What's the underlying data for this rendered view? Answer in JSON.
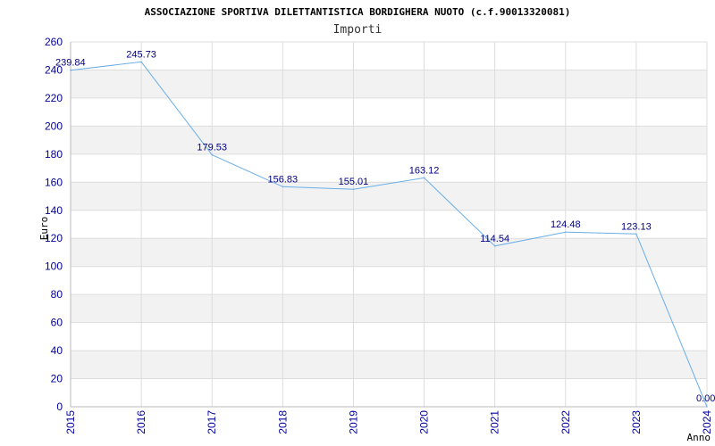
{
  "chart_data": {
    "type": "line",
    "title": "ASSOCIAZIONE SPORTIVA DILETTANTISTICA BORDIGHERA NUOTO (c.f.90013320081)",
    "subtitle": "Importi",
    "xlabel": "Anno",
    "ylabel": "Euro",
    "categories": [
      "2015",
      "2016",
      "2017",
      "2018",
      "2019",
      "2020",
      "2021",
      "2022",
      "2023",
      "2024"
    ],
    "series": [
      {
        "values": [
          239.84,
          245.73,
          179.53,
          156.83,
          155.01,
          163.12,
          114.54,
          124.48,
          123.13,
          0.0
        ]
      }
    ],
    "data_labels": [
      "239.84",
      "245.73",
      "179.53",
      "156.83",
      "155.01",
      "163.12",
      "114.54",
      "124.48",
      "123.13",
      "0.00"
    ],
    "ylim": [
      0,
      260
    ],
    "yticks": [
      0,
      20,
      40,
      60,
      80,
      100,
      120,
      140,
      160,
      180,
      200,
      220,
      240,
      260
    ],
    "grid": true,
    "legend": "none",
    "colors": {
      "line": "#6aaee8",
      "tick_text": "#0000a0",
      "label_text": "#000080",
      "band": "#f2f2f2",
      "gridline": "#dddddd",
      "axis": "#bbbbbb"
    }
  }
}
